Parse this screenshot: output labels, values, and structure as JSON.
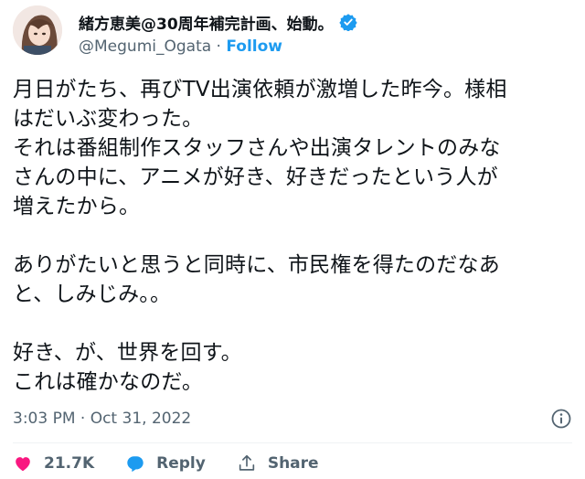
{
  "author": {
    "display_name": "緒方恵美@30周年補完計画、始動。",
    "handle": "@Megumi_Ogata",
    "separator": " · ",
    "follow_label": "Follow",
    "verified_color": "#1d9bf0"
  },
  "tweet": {
    "paragraphs": [
      [
        "月日がたち、再びTV出演依頼が激増した昨今。様相",
        "はだいぶ変わった。",
        "それは番組制作スタッフさんや出演タレントのみな",
        "さんの中に、アニメが好き、好きだったという人が",
        "増えたから。"
      ],
      [
        "ありがたいと思うと同時に、市民権を得たのだなあ",
        "と、しみじみ。。"
      ],
      [
        "好き、が、世界を回す。",
        "これは確かなのだ。"
      ]
    ],
    "timestamp": "3:03 PM · Oct 31, 2022"
  },
  "actions": {
    "like_count": "21.7K",
    "reply_label": "Reply",
    "share_label": "Share",
    "like_color": "#f91880",
    "reply_color": "#1d9bf0"
  }
}
